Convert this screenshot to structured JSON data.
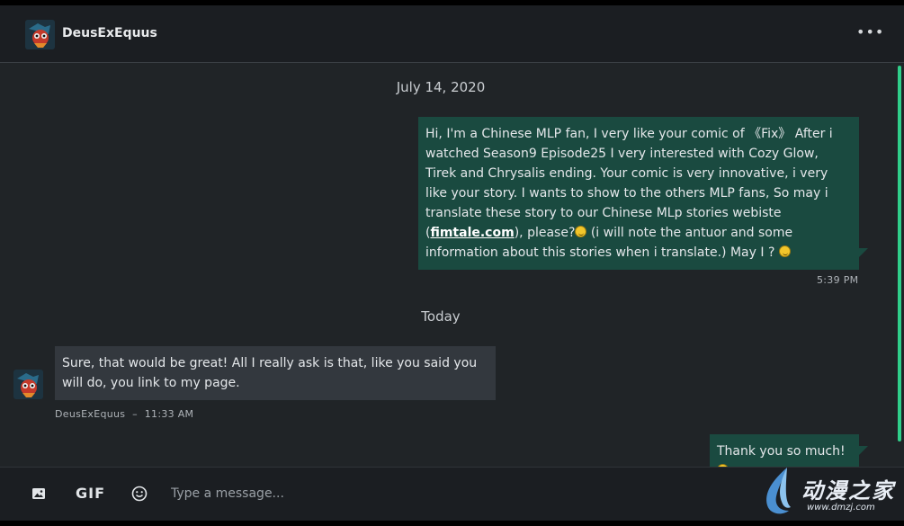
{
  "header": {
    "username": "DeusExEquus",
    "more_icon": "more-dots-icon",
    "more_glyph": "•••"
  },
  "chat": {
    "date_separators": [
      "July 14, 2020",
      "Today"
    ],
    "messages": [
      {
        "direction": "outgoing",
        "text_before_link": "Hi, I'm a Chinese MLP fan, I very like your comic of 《Fix》 After i watched Season9 Episode25 I very interested with Cozy Glow, Tirek and Chrysalis ending. Your comic is very innovative, i very like your story. I wants to show to the others MLP fans, So may i translate these story to our Chinese MLp stories webiste (",
        "link": "fimtale.com",
        "text_after_link": "), please?",
        "text_tail": " (i will note the antuor and some information about this stories when i translate.) May I ? ",
        "time": "5:39 PM"
      },
      {
        "direction": "incoming",
        "text": "Sure, that would be great! All I really ask is that, like you said you will do, you link to my page.",
        "sender": "DeusExEquus",
        "time": "11:33 AM",
        "meta_separator": "–"
      },
      {
        "direction": "outgoing",
        "text": "Thank you so much!"
      }
    ]
  },
  "composer": {
    "image_icon": "image-icon",
    "gif_label": "GIF",
    "emoji_icon": "emoji-icon",
    "placeholder": "Type a message..."
  },
  "watermark": {
    "text": "动漫之家",
    "url": "www.dmzj.com"
  },
  "colors": {
    "accent_scrollbar": "#2fcf8a",
    "outgoing_bubble": "#1a4a40",
    "incoming_bubble": "#33383e",
    "background": "#202427"
  }
}
